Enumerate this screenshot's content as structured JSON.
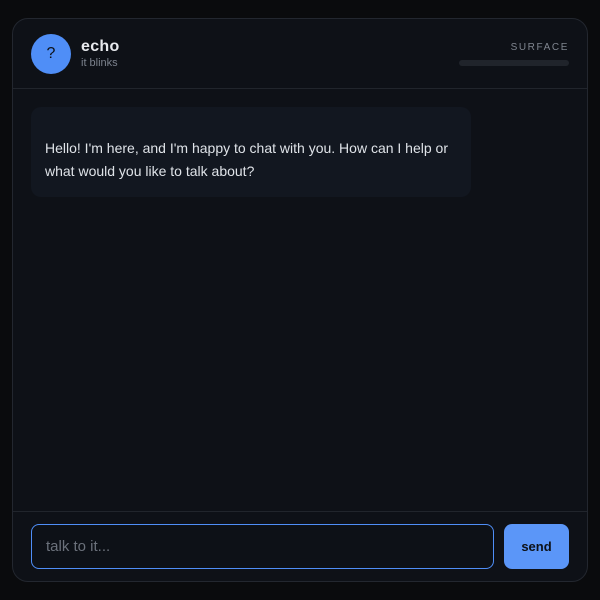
{
  "header": {
    "avatar_glyph": "?",
    "app_name": "echo",
    "subtitle": "it blinks",
    "surface_label": "SURFACE",
    "surface_level": 0
  },
  "messages": [
    {
      "role": "assistant",
      "text": "Hello! I'm here, and I'm happy to chat with you. How can I help or what would you like to talk about?"
    }
  ],
  "composer": {
    "placeholder": "talk to it...",
    "value": "",
    "send_label": "send"
  },
  "colors": {
    "accent": "#4f8ef7",
    "background": "#0a0b0d",
    "panel": "#0e1117",
    "bubble": "#121720"
  }
}
